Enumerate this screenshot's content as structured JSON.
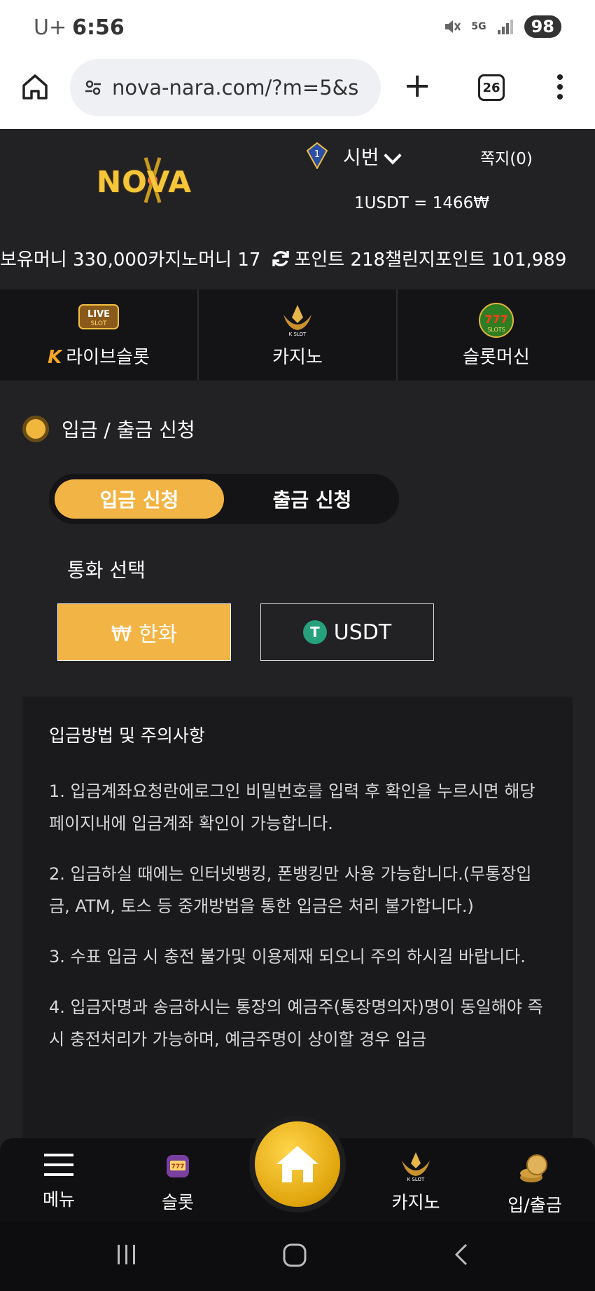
{
  "status_bar": {
    "carrier": "U+",
    "time": "6:56",
    "battery": "98",
    "network": "5G"
  },
  "browser": {
    "url": "nova-nara.com/?m=5&s",
    "tab_count": "26",
    "load_progress": 0.82
  },
  "header": {
    "logo": "NOVA",
    "rank_badge": "1",
    "rank_name": "시번",
    "message": "쪽지(0)",
    "rate": "1USDT = 1466₩",
    "balances": {
      "money": "보유머니 330,000",
      "casino_money": "카지노머니 17",
      "points": "포인트 218",
      "challenge_points": "챌린지포인트 101,989"
    }
  },
  "games_nav": [
    {
      "label": "라이브슬롯",
      "icon": "live-slot-icon"
    },
    {
      "label": "카지노",
      "icon": "k-slot-icon"
    },
    {
      "label": "슬롯머신",
      "icon": "777-slots-icon"
    }
  ],
  "section": {
    "title": "입금 / 출금 신청",
    "tab_deposit": "입금 신청",
    "tab_withdraw": "출금 신청",
    "currency_label": "통화 선택",
    "currency_krw": "₩ 한화",
    "currency_usdt": "USDT"
  },
  "notice": {
    "title": "입금방법 및 주의사항",
    "items": [
      "1. 입금계좌요청란에로그인 비밀번호를 입력 후 확인을 누르시면 해당 페이지내에 입금계좌 확인이 가능합니다.",
      "2. 입금하실 때에는 인터넷뱅킹, 폰뱅킹만 사용 가능합니다.(무통장입금, ATM, 토스 등 중개방법을 통한 입금은 처리 불가합니다.)",
      "3. 수표 입금 시 충전 불가및 이용제재 되오니 주의 하시길 바랍니다.",
      "4. 입금자명과 송금하시는 통장의 예금주(통장명의자)명이 동일해야 즉시 충전처리가 가능하며, 예금주명이 상이할 경우 입금"
    ]
  },
  "bottom_nav": {
    "menu": "메뉴",
    "slot": "슬롯",
    "casino": "카지노",
    "deposit": "입/출금"
  },
  "colors": {
    "accent": "#f2b444",
    "background": "#222225",
    "panel": "#1a1a1d"
  }
}
